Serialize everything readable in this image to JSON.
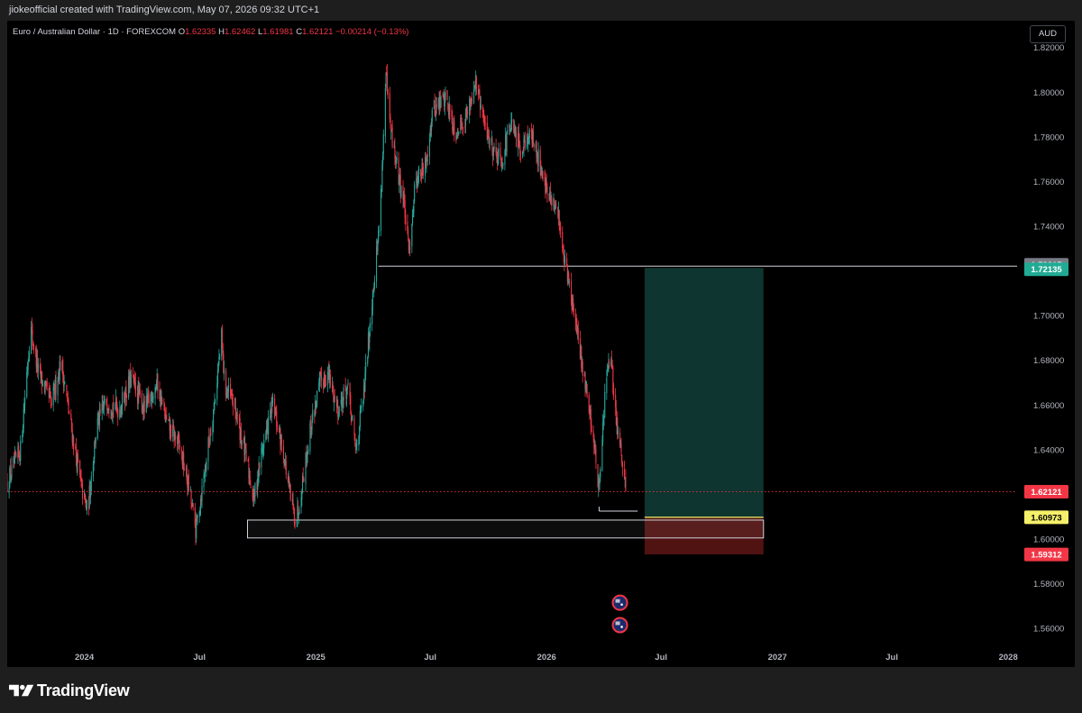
{
  "header": {
    "credit": "jiokeofficial created with TradingView.com, May 07, 2026 09:32 UTC+1"
  },
  "legend": {
    "symbol": "Euro / Australian Dollar · 1D · FOREXCOM",
    "open_label": "O",
    "open": "1.62335",
    "high_label": "H",
    "high": "1.62462",
    "low_label": "L",
    "low": "1.61981",
    "close_label": "C",
    "close": "1.62121",
    "change": "−0.00214 (−0.13%)"
  },
  "currency": "AUD",
  "footer": {
    "brand": "TradingView"
  },
  "colors": {
    "up": "#26a69a",
    "down": "#f23645",
    "profit_zone": "#0f3b34",
    "loss_zone": "#5a1414",
    "target_badge": "#22ab94",
    "entry_badge": "#f5f06a",
    "stop_badge": "#f23645",
    "last_price_badge": "#f23645",
    "line_badge": "#787b86"
  },
  "chart_data": {
    "type": "candlestick",
    "symbol": "EURAUD",
    "timeframe": "1D",
    "y_axis": {
      "range": [
        1.552,
        1.832
      ],
      "ticks": [
        "1.82000",
        "1.80000",
        "1.78000",
        "1.76000",
        "1.74000",
        "1.72000",
        "1.70000",
        "1.68000",
        "1.66000",
        "1.64000",
        "1.62000",
        "1.60000",
        "1.58000",
        "1.56000"
      ]
    },
    "x_axis": {
      "range": [
        "2023-09-01",
        "2028-01-15"
      ],
      "ticks": [
        {
          "label": "2024",
          "date": "2024-01-01"
        },
        {
          "label": "Jul",
          "date": "2024-07-01"
        },
        {
          "label": "2025",
          "date": "2025-01-01"
        },
        {
          "label": "Jul",
          "date": "2025-07-01"
        },
        {
          "label": "2026",
          "date": "2026-01-01"
        },
        {
          "label": "Jul",
          "date": "2026-07-01"
        },
        {
          "label": "2027",
          "date": "2027-01-01"
        },
        {
          "label": "Jul",
          "date": "2027-07-01"
        },
        {
          "label": "2028",
          "date": "2028-01-01"
        }
      ]
    },
    "price_path": [
      [
        "2023-09-01",
        1.625
      ],
      [
        "2023-09-22",
        1.64
      ],
      [
        "2023-10-08",
        1.695
      ],
      [
        "2023-10-20",
        1.675
      ],
      [
        "2023-11-10",
        1.66
      ],
      [
        "2023-11-25",
        1.68
      ],
      [
        "2023-12-10",
        1.652
      ],
      [
        "2023-12-28",
        1.622
      ],
      [
        "2024-01-06",
        1.612
      ],
      [
        "2024-01-20",
        1.65
      ],
      [
        "2024-02-05",
        1.662
      ],
      [
        "2024-02-25",
        1.658
      ],
      [
        "2024-03-15",
        1.672
      ],
      [
        "2024-04-05",
        1.658
      ],
      [
        "2024-04-25",
        1.67
      ],
      [
        "2024-05-10",
        1.652
      ],
      [
        "2024-05-30",
        1.642
      ],
      [
        "2024-06-15",
        1.622
      ],
      [
        "2024-06-25",
        1.604
      ],
      [
        "2024-07-05",
        1.622
      ],
      [
        "2024-07-25",
        1.662
      ],
      [
        "2024-08-05",
        1.69
      ],
      [
        "2024-08-10",
        1.668
      ],
      [
        "2024-08-25",
        1.66
      ],
      [
        "2024-09-10",
        1.64
      ],
      [
        "2024-09-25",
        1.618
      ],
      [
        "2024-10-08",
        1.64
      ],
      [
        "2024-10-25",
        1.66
      ],
      [
        "2024-11-10",
        1.64
      ],
      [
        "2024-11-22",
        1.618
      ],
      [
        "2024-12-01",
        1.608
      ],
      [
        "2024-12-12",
        1.628
      ],
      [
        "2024-12-25",
        1.652
      ],
      [
        "2025-01-08",
        1.67
      ],
      [
        "2025-01-20",
        1.674
      ],
      [
        "2025-02-05",
        1.658
      ],
      [
        "2025-02-20",
        1.668
      ],
      [
        "2025-03-05",
        1.64
      ],
      [
        "2025-03-18",
        1.665
      ],
      [
        "2025-03-30",
        1.705
      ],
      [
        "2025-04-05",
        1.722
      ],
      [
        "2025-04-12",
        1.742
      ],
      [
        "2025-04-18",
        1.78
      ],
      [
        "2025-04-22",
        1.808
      ],
      [
        "2025-04-28",
        1.785
      ],
      [
        "2025-05-10",
        1.765
      ],
      [
        "2025-05-20",
        1.752
      ],
      [
        "2025-05-28",
        1.728
      ],
      [
        "2025-06-08",
        1.762
      ],
      [
        "2025-06-22",
        1.765
      ],
      [
        "2025-07-05",
        1.792
      ],
      [
        "2025-07-25",
        1.798
      ],
      [
        "2025-08-10",
        1.782
      ],
      [
        "2025-08-28",
        1.79
      ],
      [
        "2025-09-10",
        1.805
      ],
      [
        "2025-09-25",
        1.785
      ],
      [
        "2025-10-08",
        1.775
      ],
      [
        "2025-10-22",
        1.77
      ],
      [
        "2025-11-05",
        1.785
      ],
      [
        "2025-11-20",
        1.775
      ],
      [
        "2025-12-05",
        1.782
      ],
      [
        "2025-12-20",
        1.77
      ],
      [
        "2026-01-05",
        1.752
      ],
      [
        "2026-01-20",
        1.745
      ],
      [
        "2026-01-28",
        1.728
      ],
      [
        "2026-02-08",
        1.71
      ],
      [
        "2026-02-20",
        1.688
      ],
      [
        "2026-03-02",
        1.672
      ],
      [
        "2026-03-15",
        1.648
      ],
      [
        "2026-03-25",
        1.622
      ],
      [
        "2026-04-05",
        1.672
      ],
      [
        "2026-04-12",
        1.68
      ],
      [
        "2026-04-22",
        1.652
      ],
      [
        "2026-05-01",
        1.632
      ],
      [
        "2026-05-07",
        1.62121
      ]
    ],
    "horizontal_lines": [
      {
        "price": 1.72217,
        "from": "2025-04-10",
        "label": "1.72217"
      }
    ],
    "support_zone": {
      "from": "2024-09-15",
      "to": "2026-12-10",
      "top": 1.6085,
      "bottom": 1.6005
    },
    "swing_low_marker": {
      "price": 1.6125,
      "from": "2026-03-25",
      "to": "2026-05-25"
    },
    "position": {
      "side": "long",
      "from": "2026-06-05",
      "to": "2026-12-10",
      "entry": 1.60973,
      "target": 1.72135,
      "stop": 1.59312
    },
    "price_labels": {
      "line": "1.72217",
      "target": "1.72135",
      "last": "1.62121",
      "entry": "1.60973",
      "stop": "1.59312"
    },
    "event_markers": [
      {
        "date": "2026-04-27",
        "price": 1.5715,
        "symbol": "AU"
      },
      {
        "date": "2026-04-27",
        "price": 1.5615,
        "symbol": "AU"
      }
    ]
  }
}
